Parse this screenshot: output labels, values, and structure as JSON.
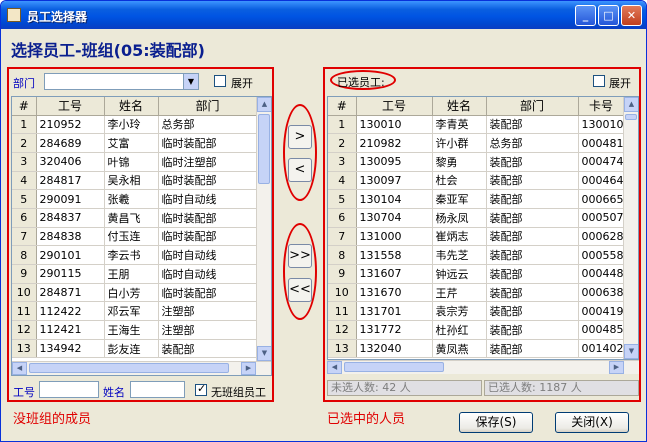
{
  "window": {
    "title": "员工选择器"
  },
  "heading": "选择员工-班组(05:装配部)",
  "left": {
    "dept_label": "部门",
    "dept_value": "",
    "expand_label": "展开",
    "columns": [
      "#",
      "工号",
      "姓名",
      "部门"
    ],
    "rows": [
      [
        "1",
        "210952",
        "李小玲",
        "总务部"
      ],
      [
        "2",
        "284689",
        "艾富",
        "临时装配部"
      ],
      [
        "3",
        "320406",
        "叶锦",
        "临时注塑部"
      ],
      [
        "4",
        "284817",
        "吴永相",
        "临时装配部"
      ],
      [
        "5",
        "290091",
        "张羲",
        "临时自动线"
      ],
      [
        "6",
        "284837",
        "黄昌飞",
        "临时装配部"
      ],
      [
        "7",
        "284838",
        "付玉连",
        "临时装配部"
      ],
      [
        "8",
        "290101",
        "李云书",
        "临时自动线"
      ],
      [
        "9",
        "290115",
        "王朋",
        "临时自动线"
      ],
      [
        "10",
        "284871",
        "白小芳",
        "临时装配部"
      ],
      [
        "11",
        "112422",
        "邓云军",
        "注塑部"
      ],
      [
        "12",
        "112421",
        "王海生",
        "注塑部"
      ],
      [
        "13",
        "134942",
        "彭友连",
        "装配部"
      ]
    ],
    "id_label": "工号",
    "name_label": "姓名",
    "no_team_label": "无班组员工",
    "caption": "没班组的成员"
  },
  "right": {
    "selected_label": "已选员工:",
    "expand_label": "展开",
    "columns": [
      "#",
      "工号",
      "姓名",
      "部门",
      "卡号"
    ],
    "rows": [
      [
        "1",
        "130010",
        "李青英",
        "装配部",
        "130010"
      ],
      [
        "2",
        "210982",
        "许小群",
        "总务部",
        "000481"
      ],
      [
        "3",
        "130095",
        "黎勇",
        "装配部",
        "000474"
      ],
      [
        "4",
        "130097",
        "杜会",
        "装配部",
        "000464"
      ],
      [
        "5",
        "130104",
        "秦亚军",
        "装配部",
        "000665"
      ],
      [
        "6",
        "130704",
        "杨永凤",
        "装配部",
        "000507"
      ],
      [
        "7",
        "131000",
        "崔炳志",
        "装配部",
        "000628"
      ],
      [
        "8",
        "131558",
        "韦先芝",
        "装配部",
        "000558"
      ],
      [
        "9",
        "131607",
        "钟远云",
        "装配部",
        "000448"
      ],
      [
        "10",
        "131670",
        "王芹",
        "装配部",
        "000638"
      ],
      [
        "11",
        "131701",
        "袁宗芳",
        "装配部",
        "000419"
      ],
      [
        "12",
        "131772",
        "杜孙红",
        "装配部",
        "000485"
      ],
      [
        "13",
        "132040",
        "黄凤燕",
        "装配部",
        "001402"
      ]
    ],
    "unselected_count": "未选人数: 42 人",
    "selected_count": "已选人数: 1187 人",
    "caption": "已选中的人员"
  },
  "transfer": {
    "add_one": ">",
    "remove_one": "<",
    "add_all": ">>",
    "remove_all": "<<"
  },
  "buttons": {
    "save": "保存(S)",
    "close": "关闭(X)"
  },
  "colors": {
    "annotation_red": "#e00000",
    "heading_blue": "#0a1f8f",
    "title_bar": "#0054e3"
  }
}
